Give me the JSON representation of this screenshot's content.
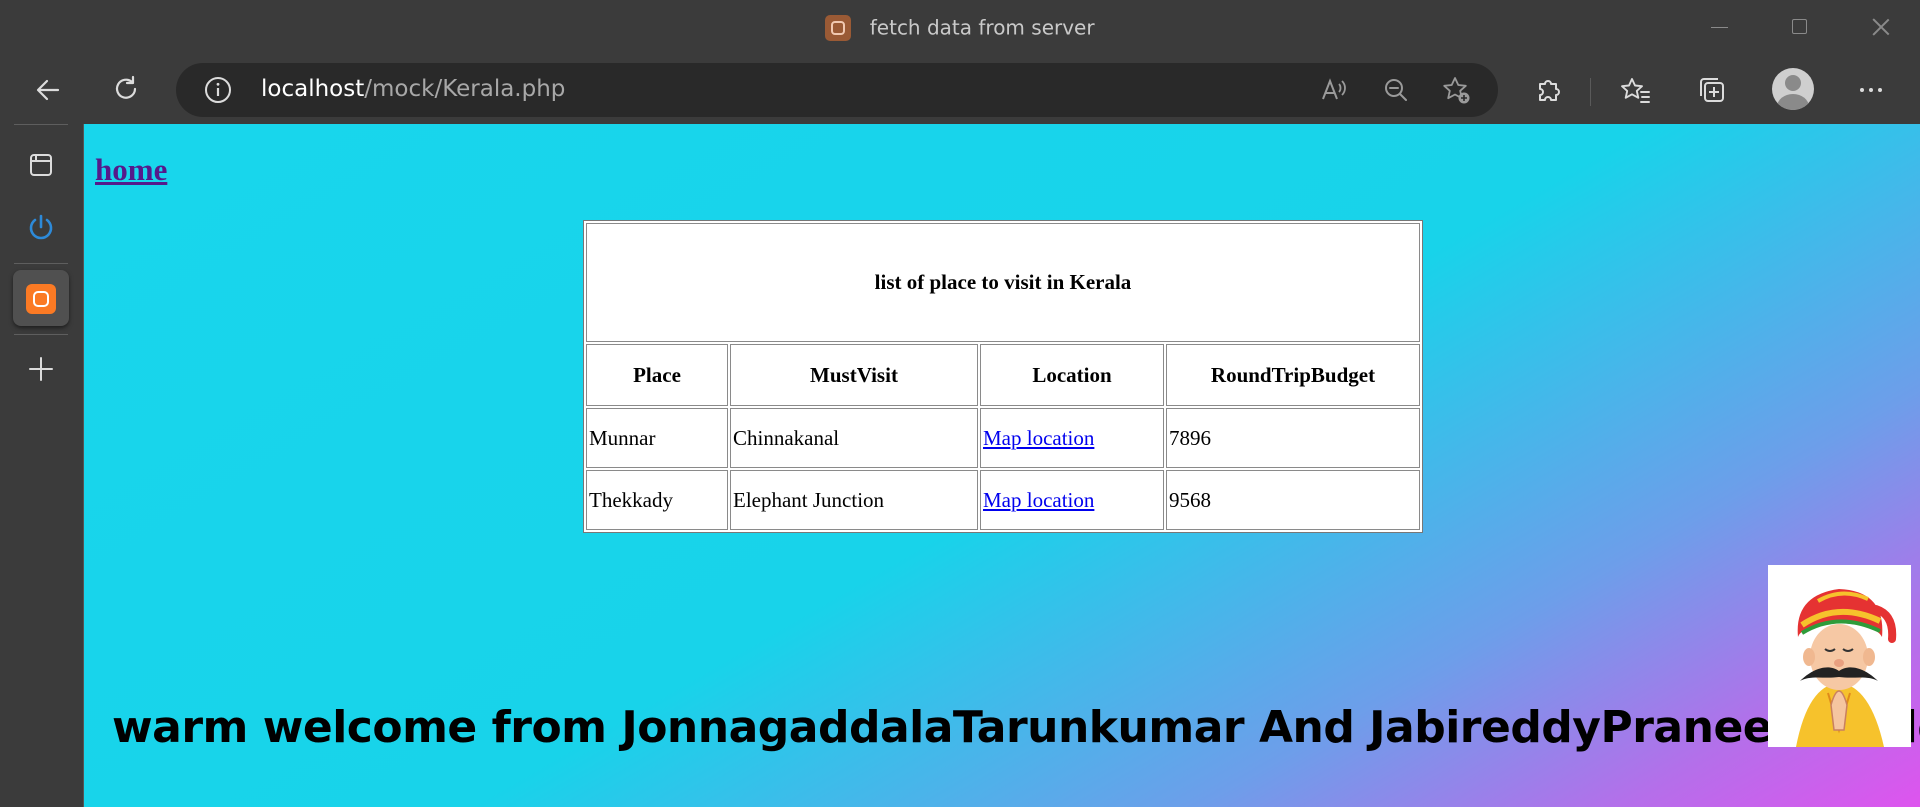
{
  "window": {
    "title": "fetch data from server"
  },
  "toolbar": {
    "url_host": "localhost",
    "url_path": "/mock/Kerala.php"
  },
  "page": {
    "home_link": "home",
    "table": {
      "title": "list of place to visit in Kerala",
      "headers": [
        "Place",
        "MustVisit",
        "Location",
        "RoundTripBudget"
      ],
      "rows": [
        {
          "place": "Munnar",
          "mustvisit": "Chinnakanal",
          "location": "Map location",
          "budget": "7896"
        },
        {
          "place": "Thekkady",
          "mustvisit": "Elephant Junction",
          "location": "Map location",
          "budget": "9568"
        }
      ]
    },
    "welcome": "warm welcome from JonnagaddalaTarunkumar And JabireddyPraneethReddy"
  },
  "colors": {
    "link_visited": "#551a8b",
    "link": "#0000ee",
    "gradient_start": "#18d6ec",
    "gradient_end": "#de54ee",
    "sidebar_power": "#2d8ad9",
    "xampp_orange": "#fb7a24"
  },
  "icons": {
    "toolbar": [
      "back-arrow-icon",
      "refresh-icon",
      "info-icon",
      "read-aloud-icon",
      "zoom-out-icon",
      "add-favorite-icon",
      "extensions-icon",
      "favorites-icon",
      "collections-icon",
      "profile-avatar",
      "more-icon"
    ],
    "sidebar": [
      "tab-actions-icon",
      "power-icon",
      "xampp-icon",
      "add-icon"
    ]
  }
}
